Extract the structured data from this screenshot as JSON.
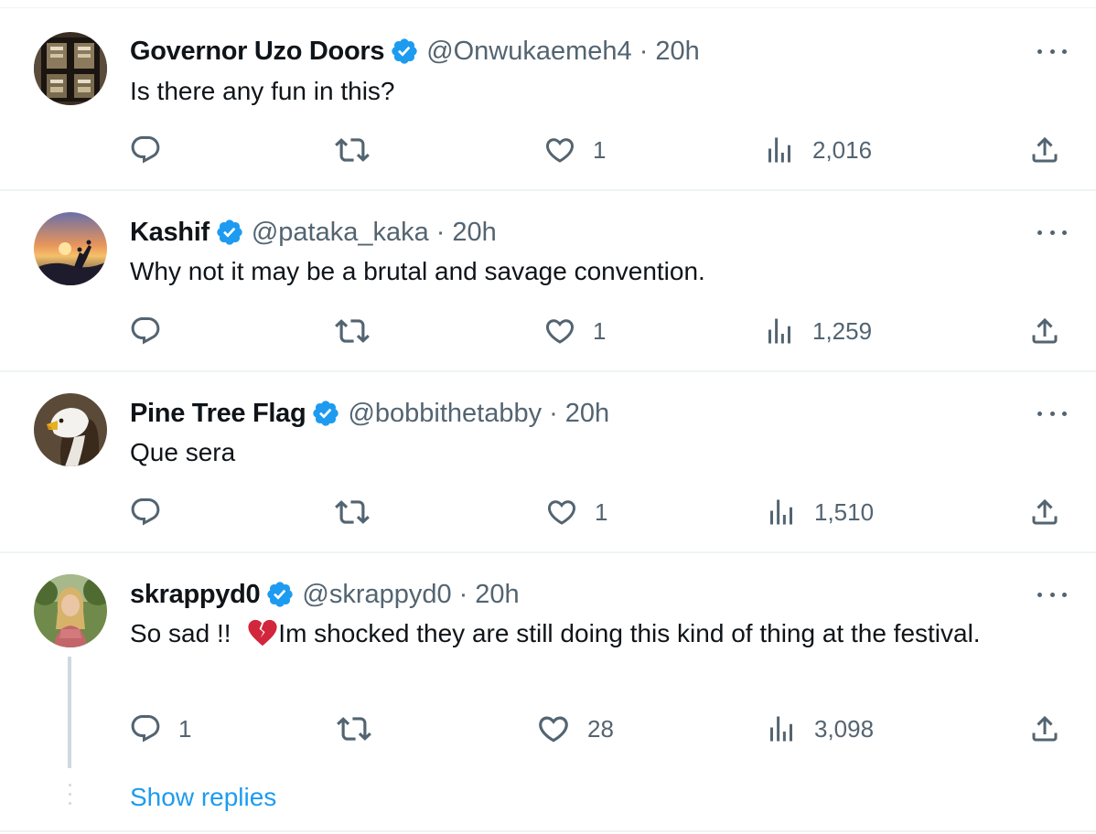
{
  "tweets": [
    {
      "name": "Governor Uzo Doors",
      "handle": "@Onwukaemeh4",
      "separator": "·",
      "time": "20h",
      "text": "Is there any fun in this?",
      "replies": "",
      "likes": "1",
      "views": "2,016"
    },
    {
      "name": "Kashif",
      "handle": "@pataka_kaka",
      "separator": "·",
      "time": "20h",
      "text": "Why not it may be a brutal and savage convention.",
      "replies": "",
      "likes": "1",
      "views": "1,259"
    },
    {
      "name": "Pine Tree Flag",
      "handle": "@bobbithetabby",
      "separator": "·",
      "time": "20h",
      "text": "Que sera",
      "replies": "",
      "likes": "1",
      "views": "1,510"
    },
    {
      "name": "skrappyd0",
      "handle": "@skrappyd0",
      "separator": "·",
      "time": "20h",
      "text_before_emoji": "So sad !! ",
      "emoji": "broken-heart",
      "text_after_emoji": "Im shocked they are still doing this kind of thing at the festival.",
      "replies": "1",
      "likes": "28",
      "views": "3,098"
    }
  ],
  "show_replies": "Show replies",
  "colors": {
    "verified": "#1d9bf0",
    "secondary_text": "#536471",
    "link": "#1d9bf0",
    "divider": "#eff3f4"
  },
  "icons": [
    "reply-icon",
    "retweet-icon",
    "like-icon",
    "views-icon",
    "share-icon",
    "more-icon",
    "verified-badge-icon"
  ]
}
